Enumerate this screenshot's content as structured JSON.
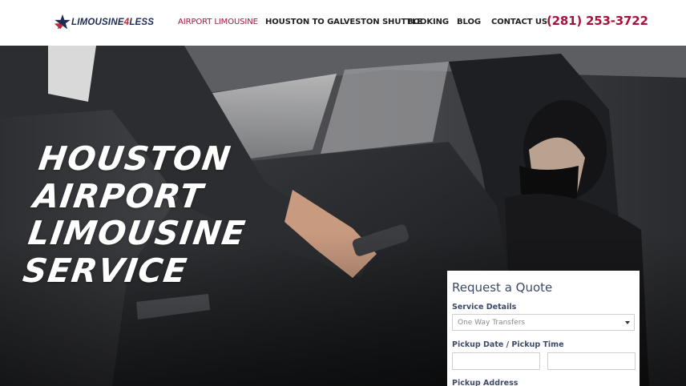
{
  "brand": {
    "name_part1": "LIMOUSINE",
    "name_four": "4",
    "name_part2": "LESS",
    "star_colors": [
      "#1d2b55",
      "#c0283a"
    ]
  },
  "nav": {
    "items": [
      {
        "label": "AIRPORT LIMOUSINE",
        "active": true
      },
      {
        "label": "HOUSTON TO GALVESTON SHUTTLE",
        "active": false
      },
      {
        "label": "BOOKING",
        "active": false
      },
      {
        "label": "BLOG",
        "active": false
      },
      {
        "label": "CONTACT US",
        "active": false
      }
    ],
    "phone": "(281) 253-3722"
  },
  "hero": {
    "title_lines": [
      "HOUSTON",
      "AIRPORT",
      "LIMOUSINE",
      "SERVICE"
    ]
  },
  "quote": {
    "heading": "Request a Quote",
    "service_label": "Service Details",
    "service_value": "One Way Transfers",
    "pickup_label": "Pickup Date / Pickup Time",
    "address_label": "Pickup Address"
  },
  "colors": {
    "accent": "#a6133a",
    "text_dark": "#3d4a66"
  }
}
